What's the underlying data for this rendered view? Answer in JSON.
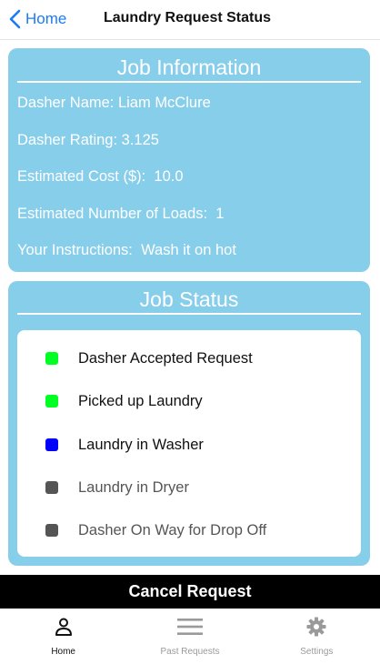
{
  "nav": {
    "back_label": "Home",
    "title": "Laundry Request Status",
    "accent_color": "#1a7cf5"
  },
  "job_info": {
    "title": "Job Information",
    "rows": [
      {
        "label": "Dasher Name:",
        "value": "Liam McClure"
      },
      {
        "label": "Dasher Rating:",
        "value": "3.125"
      },
      {
        "label": "Estimated Cost ($):",
        "value": "10.0"
      },
      {
        "label": "Estimated Number of Loads:",
        "value": "1"
      },
      {
        "label": "Your Instructions:",
        "value": "Wash it on hot"
      }
    ],
    "card_color": "#87ceeb"
  },
  "job_status": {
    "title": "Job Status",
    "steps": [
      {
        "label": "Dasher Accepted Request",
        "state": "complete",
        "color": "#00ff22"
      },
      {
        "label": "Picked up Laundry",
        "state": "complete",
        "color": "#00ff22"
      },
      {
        "label": "Laundry in Washer",
        "state": "current",
        "color": "#0000ff"
      },
      {
        "label": "Laundry in Dryer",
        "state": "pending",
        "color": "#555555"
      },
      {
        "label": "Dasher On Way for Drop Off",
        "state": "pending",
        "color": "#555555"
      }
    ]
  },
  "cancel_button": {
    "label": "Cancel Request"
  },
  "tabbar": {
    "tabs": [
      {
        "label": "Home",
        "icon": "person-icon",
        "active": true
      },
      {
        "label": "Past Requests",
        "icon": "menu-lines-icon",
        "active": false
      },
      {
        "label": "Settings",
        "icon": "gear-icon",
        "active": false
      }
    ]
  }
}
